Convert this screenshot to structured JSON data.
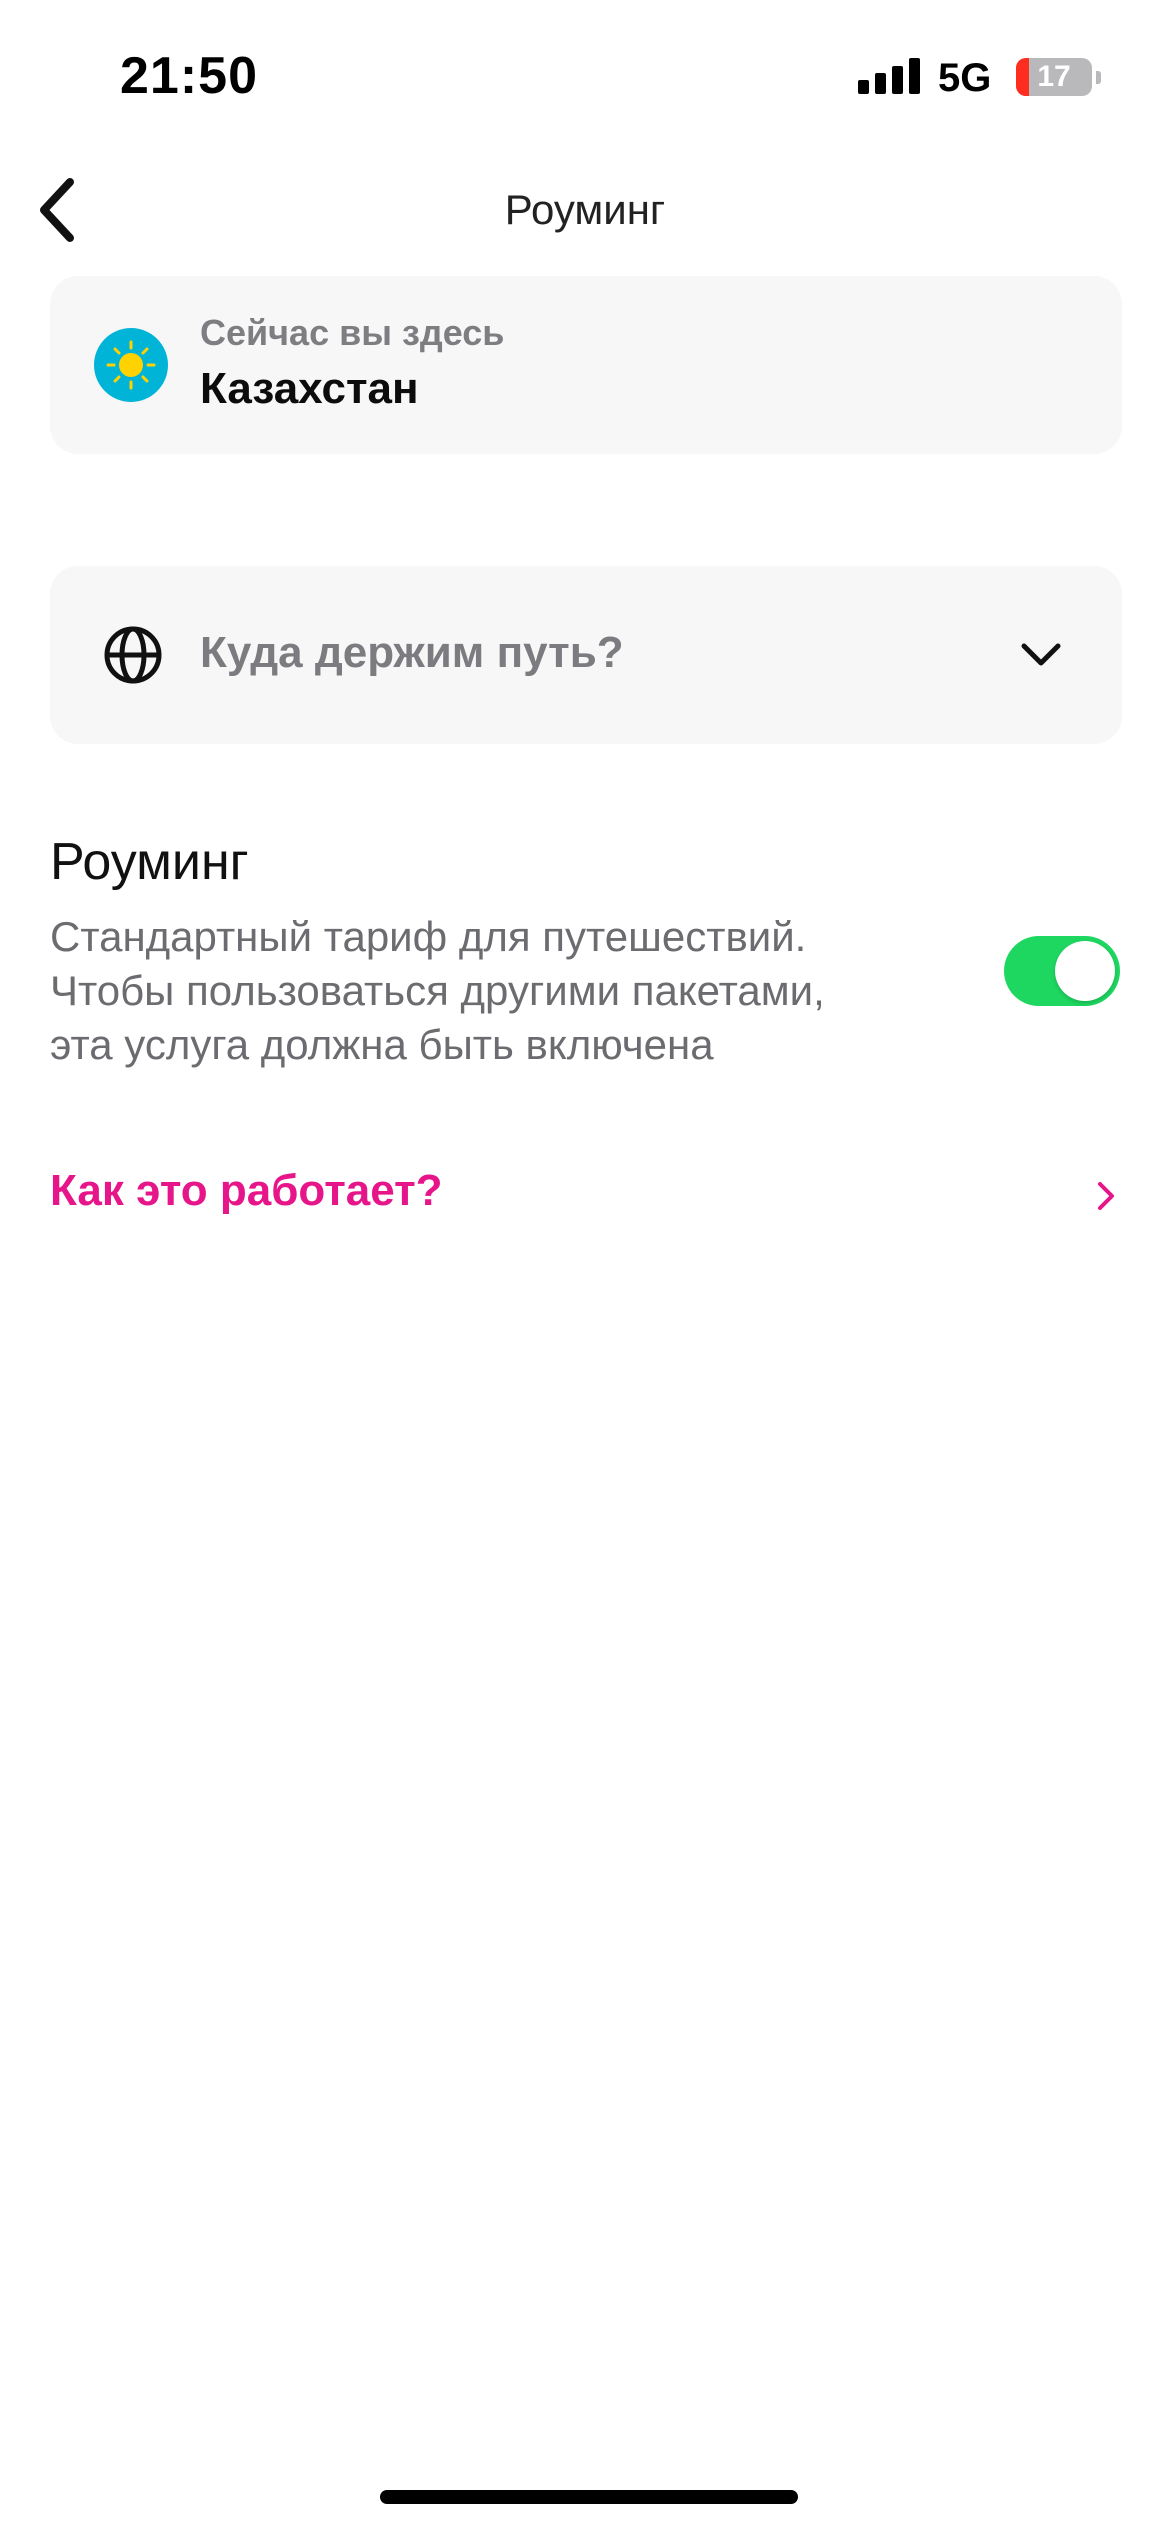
{
  "status_bar": {
    "time": "21:50",
    "network": "5G",
    "battery_percent": "17",
    "battery_level": 0.17,
    "battery_color": "#ff2d20"
  },
  "nav": {
    "title": "Роуминг",
    "back_icon": "chevron-left-icon"
  },
  "current_location": {
    "label": "Сейчас вы здесь",
    "country": "Казахстан",
    "flag_icon": "kazakhstan-flag-icon"
  },
  "destination": {
    "placeholder": "Куда держим путь?",
    "icon": "globe-icon",
    "dropdown_icon": "chevron-down-icon"
  },
  "roaming": {
    "title": "Роуминг",
    "description_lines": [
      "Стандартный тариф для путешествий.",
      "Чтобы пользоваться другими пакетами,",
      "эта услуга должна быть включена"
    ],
    "enabled": true,
    "toggle_color": "#1ed760"
  },
  "help_link": {
    "label": "Как это работает?",
    "color": "#e6168a",
    "icon": "chevron-right-icon"
  }
}
